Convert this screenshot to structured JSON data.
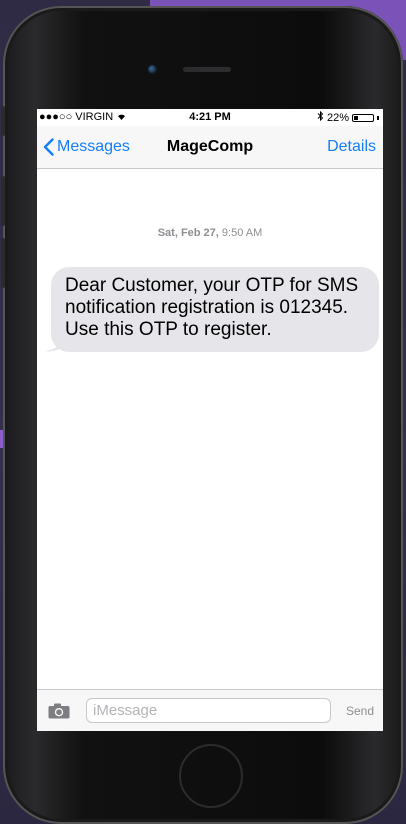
{
  "status_bar": {
    "carrier": "●●●○○ VIRGIN",
    "time": "4:21 PM",
    "battery": "22%",
    "battery_level": 0.22
  },
  "nav": {
    "back_label": "Messages",
    "title": "MageComp",
    "details_label": "Details"
  },
  "conversation": {
    "timestamp_day": "Sat, Feb 27,",
    "timestamp_time": " 9:50 AM",
    "messages": [
      {
        "text": "Dear Customer, your OTP for SMS notification registration is 012345. Use this OTP to register.",
        "direction": "incoming"
      }
    ]
  },
  "input": {
    "placeholder": "iMessage",
    "send_label": "Send"
  },
  "colors": {
    "accent": "#147efb",
    "bubble": "#e5e5ea"
  }
}
